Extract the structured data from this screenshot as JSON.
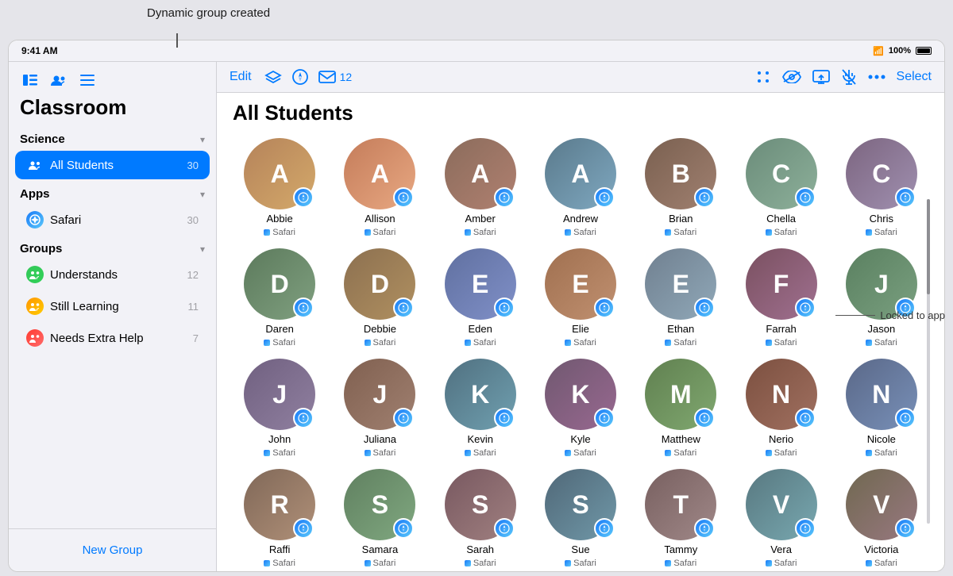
{
  "tooltip": {
    "text": "Dynamic group created"
  },
  "status_bar": {
    "time": "9:41 AM",
    "wifi": "WiFi",
    "battery_pct": "100%"
  },
  "sidebar": {
    "title": "Classroom",
    "icons": [
      "sidebar-icon",
      "people-icon",
      "list-icon"
    ],
    "edit_label": "Edit",
    "science_section": {
      "label": "Science"
    },
    "all_students": {
      "label": "All Students",
      "count": "30"
    },
    "apps_section": {
      "label": "Apps"
    },
    "safari_item": {
      "label": "Safari",
      "count": "30"
    },
    "groups_section": {
      "label": "Groups"
    },
    "groups": [
      {
        "label": "Understands",
        "count": "12",
        "color": "#34c759"
      },
      {
        "label": "Still Learning",
        "count": "11",
        "color": "#ff9500"
      },
      {
        "label": "Needs Extra Help",
        "count": "7",
        "color": "#ff3b30"
      }
    ],
    "new_group_label": "New Group"
  },
  "toolbar": {
    "three_dots": "···",
    "mail_count": "12",
    "select_label": "Select"
  },
  "main": {
    "page_title": "All Students",
    "locked_to_app_label": "Locked to app",
    "students": [
      {
        "name": "Abbie",
        "app": "Safari",
        "av": "av-1",
        "initials": "A"
      },
      {
        "name": "Allison",
        "app": "Safari",
        "av": "av-2",
        "initials": "A"
      },
      {
        "name": "Amber",
        "app": "Safari",
        "av": "av-3",
        "initials": "A"
      },
      {
        "name": "Andrew",
        "app": "Safari",
        "av": "av-4",
        "initials": "A"
      },
      {
        "name": "Brian",
        "app": "Safari",
        "av": "av-5",
        "initials": "B"
      },
      {
        "name": "Chella",
        "app": "Safari",
        "av": "av-6",
        "initials": "C"
      },
      {
        "name": "Chris",
        "app": "Safari",
        "av": "av-7",
        "initials": "C"
      },
      {
        "name": "Daren",
        "app": "Safari",
        "av": "av-8",
        "initials": "D"
      },
      {
        "name": "Debbie",
        "app": "Safari",
        "av": "av-9",
        "initials": "D"
      },
      {
        "name": "Eden",
        "app": "Safari",
        "av": "av-10",
        "initials": "E"
      },
      {
        "name": "Elie",
        "app": "Safari",
        "av": "av-11",
        "initials": "E"
      },
      {
        "name": "Ethan",
        "app": "Safari",
        "av": "av-12",
        "initials": "E"
      },
      {
        "name": "Farrah",
        "app": "Safari",
        "av": "av-13",
        "initials": "F"
      },
      {
        "name": "Jason",
        "app": "Safari",
        "av": "av-14",
        "initials": "J"
      },
      {
        "name": "John",
        "app": "Safari",
        "av": "av-15",
        "initials": "J"
      },
      {
        "name": "Juliana",
        "app": "Safari",
        "av": "av-16",
        "initials": "J"
      },
      {
        "name": "Kevin",
        "app": "Safari",
        "av": "av-17",
        "initials": "K"
      },
      {
        "name": "Kyle",
        "app": "Safari",
        "av": "av-18",
        "initials": "K"
      },
      {
        "name": "Matthew",
        "app": "Safari",
        "av": "av-19",
        "initials": "M"
      },
      {
        "name": "Nerio",
        "app": "Safari",
        "av": "av-20",
        "initials": "N"
      },
      {
        "name": "Nicole",
        "app": "Safari",
        "av": "av-21",
        "initials": "N"
      },
      {
        "name": "Raffi",
        "app": "Safari",
        "av": "av-22",
        "initials": "R"
      },
      {
        "name": "Samara",
        "app": "Safari",
        "av": "av-23",
        "initials": "S"
      },
      {
        "name": "Sarah",
        "app": "Safari",
        "av": "av-24",
        "initials": "S"
      },
      {
        "name": "Sue",
        "app": "Safari",
        "av": "av-25",
        "initials": "S"
      },
      {
        "name": "Tammy",
        "app": "Safari",
        "av": "av-26",
        "initials": "T"
      },
      {
        "name": "Vera",
        "app": "Safari",
        "av": "av-27",
        "initials": "V"
      },
      {
        "name": "Victoria",
        "app": "Safari",
        "av": "av-28",
        "initials": "V"
      }
    ]
  }
}
